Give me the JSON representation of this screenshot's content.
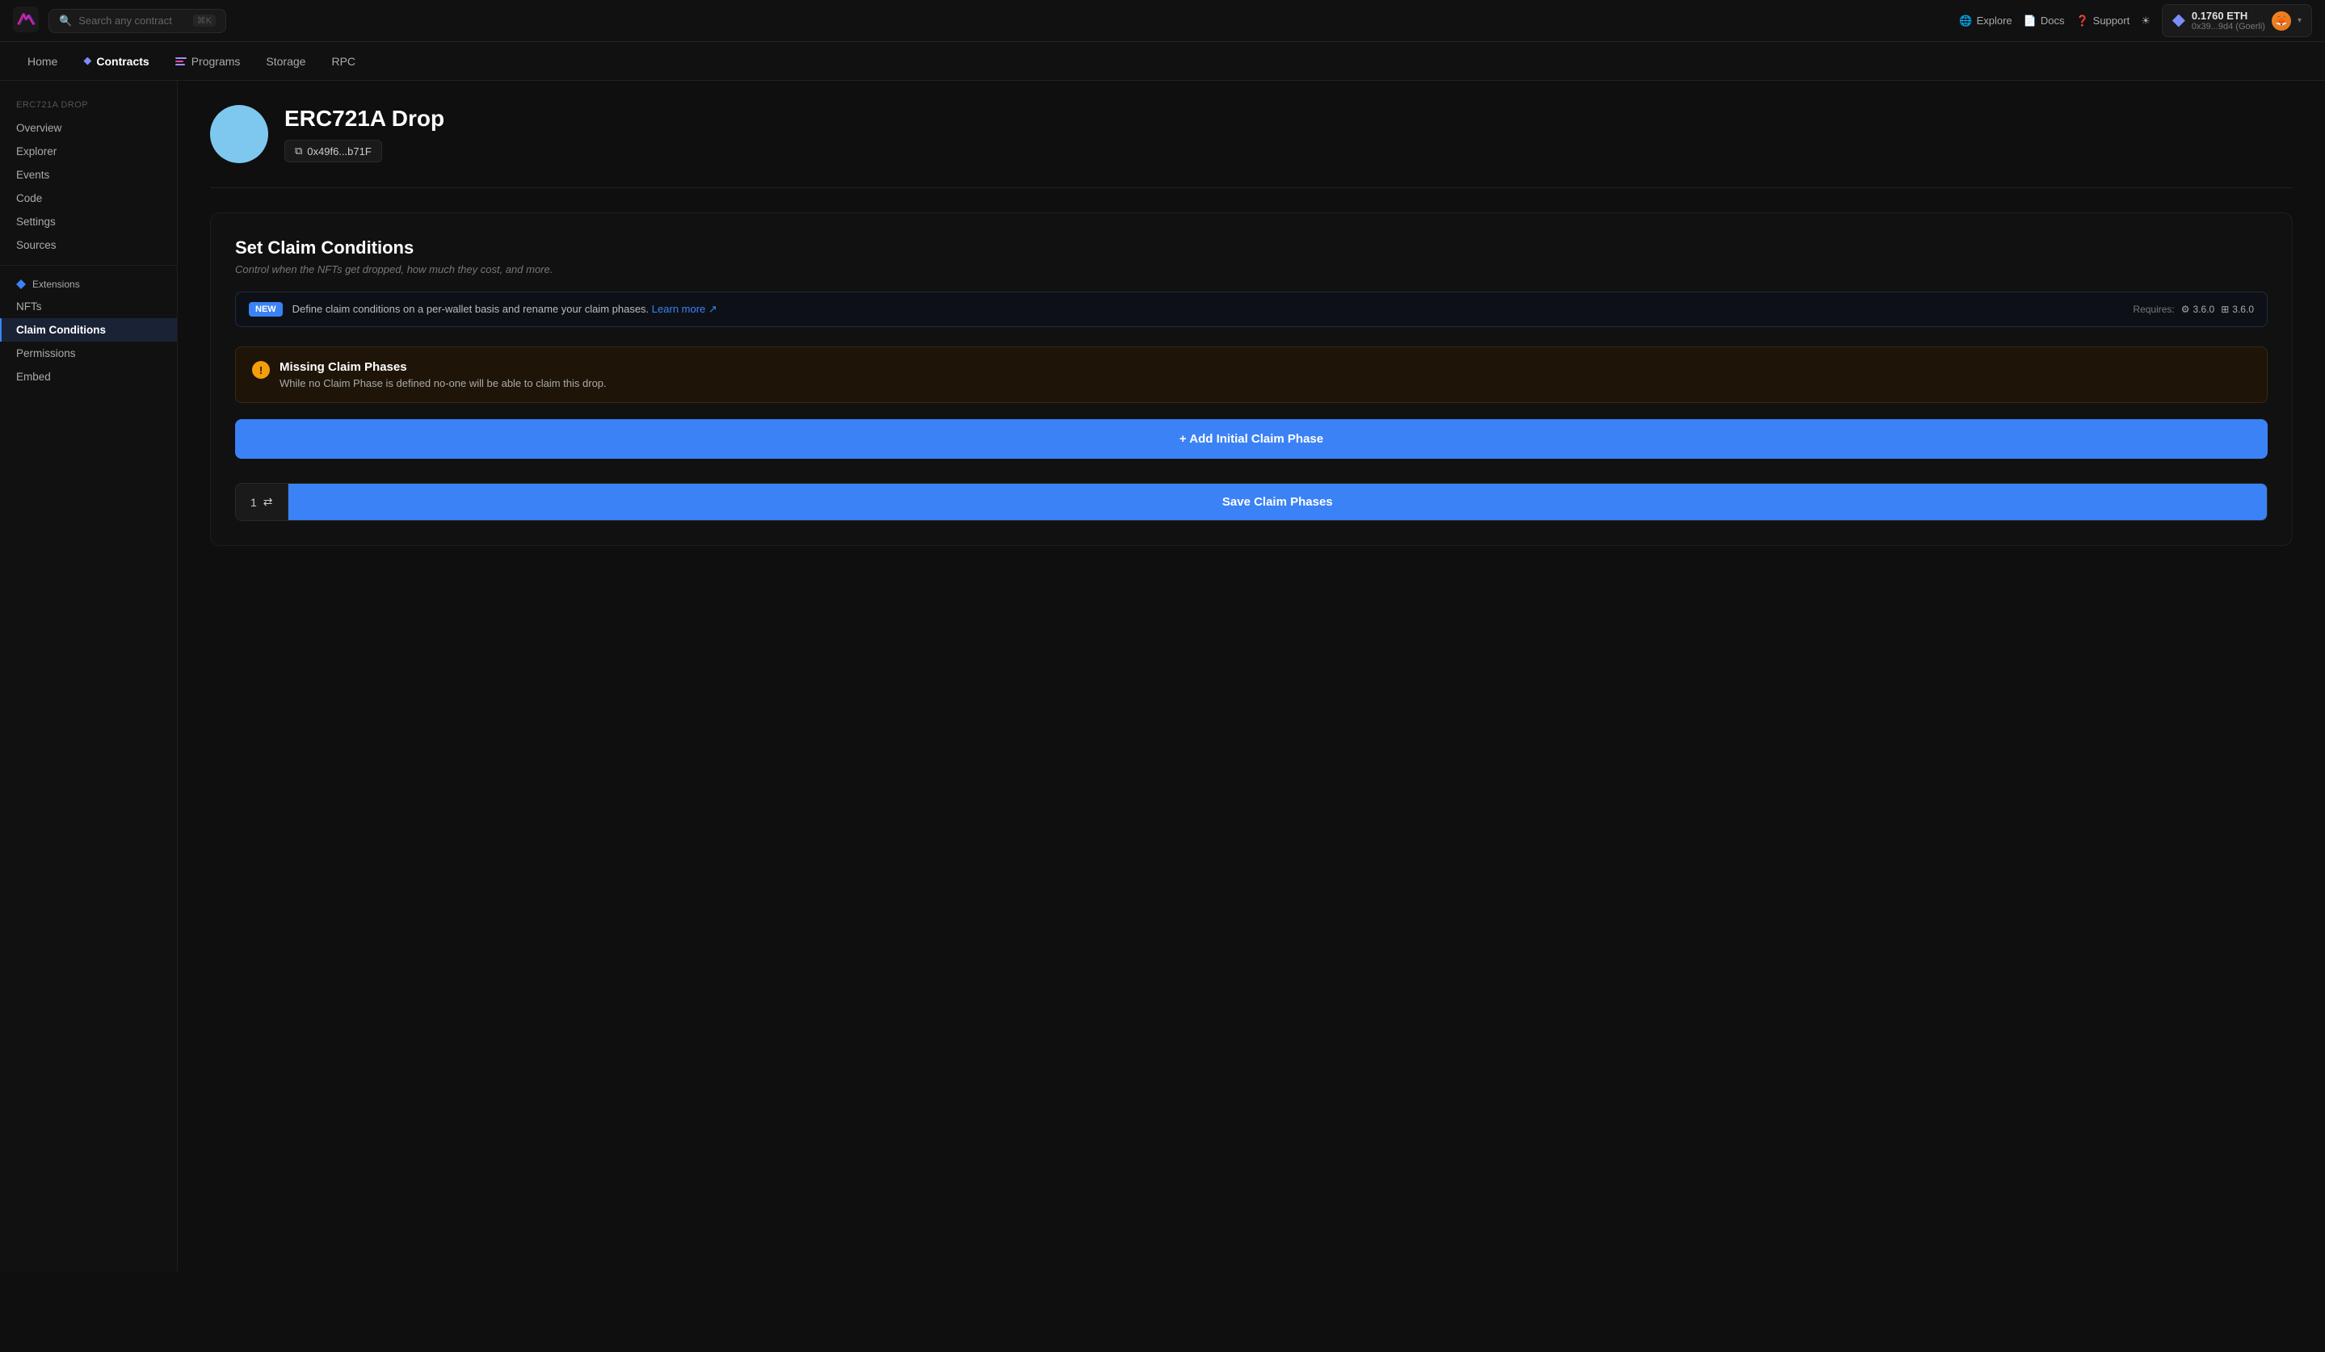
{
  "top_nav": {
    "search_placeholder": "Search any contract",
    "search_shortcut": "⌘K",
    "links": [
      {
        "id": "explore",
        "label": "Explore",
        "icon": "globe"
      },
      {
        "id": "docs",
        "label": "Docs",
        "icon": "doc"
      },
      {
        "id": "support",
        "label": "Support",
        "icon": "question"
      }
    ],
    "wallet": {
      "amount": "0.1760 ETH",
      "address": "0x39...9d4 (Goerli)"
    }
  },
  "secondary_nav": {
    "items": [
      {
        "id": "home",
        "label": "Home",
        "active": false
      },
      {
        "id": "contracts",
        "label": "Contracts",
        "active": true,
        "has_diamond": true
      },
      {
        "id": "programs",
        "label": "Programs",
        "active": false
      },
      {
        "id": "storage",
        "label": "Storage",
        "active": false
      },
      {
        "id": "rpc",
        "label": "RPC",
        "active": false
      }
    ]
  },
  "sidebar": {
    "contract_name": "ERC721A Drop",
    "nav_items": [
      {
        "id": "overview",
        "label": "Overview"
      },
      {
        "id": "explorer",
        "label": "Explorer"
      },
      {
        "id": "events",
        "label": "Events"
      },
      {
        "id": "code",
        "label": "Code"
      },
      {
        "id": "settings",
        "label": "Settings"
      },
      {
        "id": "sources",
        "label": "Sources"
      }
    ],
    "extensions_label": "Extensions",
    "extensions_items": [
      {
        "id": "nfts",
        "label": "NFTs"
      },
      {
        "id": "claim-conditions",
        "label": "Claim Conditions",
        "active": true
      },
      {
        "id": "permissions",
        "label": "Permissions"
      },
      {
        "id": "embed",
        "label": "Embed"
      }
    ]
  },
  "contract_header": {
    "title": "ERC721A Drop",
    "address": "0x49f6...b71F",
    "copy_label": "copy"
  },
  "claim_conditions": {
    "title": "Set Claim Conditions",
    "subtitle": "Control when the NFTs get dropped, how much they cost, and more.",
    "new_banner": {
      "badge": "NEW",
      "text": "Define claim conditions on a per-wallet basis and rename your claim phases.",
      "learn_more": "Learn more ↗",
      "requires_label": "Requires:",
      "version1": "3.6.0",
      "version2": "3.6.0"
    },
    "warning": {
      "title": "Missing Claim Phases",
      "text": "While no Claim Phase is defined no-one will be able to claim this drop."
    },
    "add_button": "+ Add Initial Claim Phase",
    "save_footer": {
      "count": "1",
      "swap_icon": "⇄",
      "save_label": "Save Claim Phases"
    }
  }
}
